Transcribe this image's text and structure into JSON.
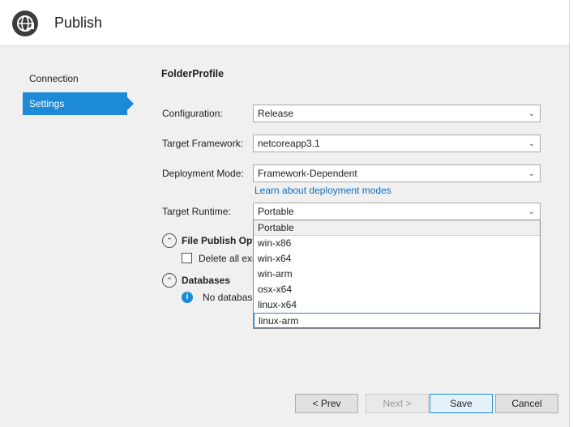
{
  "header": {
    "title": "Publish",
    "icon": "globe-publish-icon"
  },
  "nav": {
    "items": [
      {
        "label": "Connection"
      },
      {
        "label": "Settings",
        "selected": true
      }
    ]
  },
  "profile": {
    "name": "FolderProfile"
  },
  "fields": {
    "configuration": {
      "label": "Configuration:",
      "value": "Release"
    },
    "framework": {
      "label": "Target Framework:",
      "value": "netcoreapp3.1"
    },
    "deployment": {
      "label": "Deployment Mode:",
      "value": "Framework-Dependent",
      "link": "Learn about deployment modes"
    },
    "runtime": {
      "label": "Target Runtime:",
      "value": "Portable"
    }
  },
  "runtime_options": [
    "Portable",
    "win-x86",
    "win-x64",
    "win-arm",
    "osx-x64",
    "linux-x64",
    "linux-arm"
  ],
  "sections": {
    "file_publish": {
      "title": "File Publish Opti",
      "checkbox_label": "Delete all exis"
    },
    "databases": {
      "title": "Databases",
      "info": "No databas"
    }
  },
  "buttons": {
    "prev": "< Prev",
    "next": "Next >",
    "save": "Save",
    "cancel": "Cancel"
  },
  "colors": {
    "accent": "#1c8ad6",
    "link": "#0e6cc5"
  }
}
